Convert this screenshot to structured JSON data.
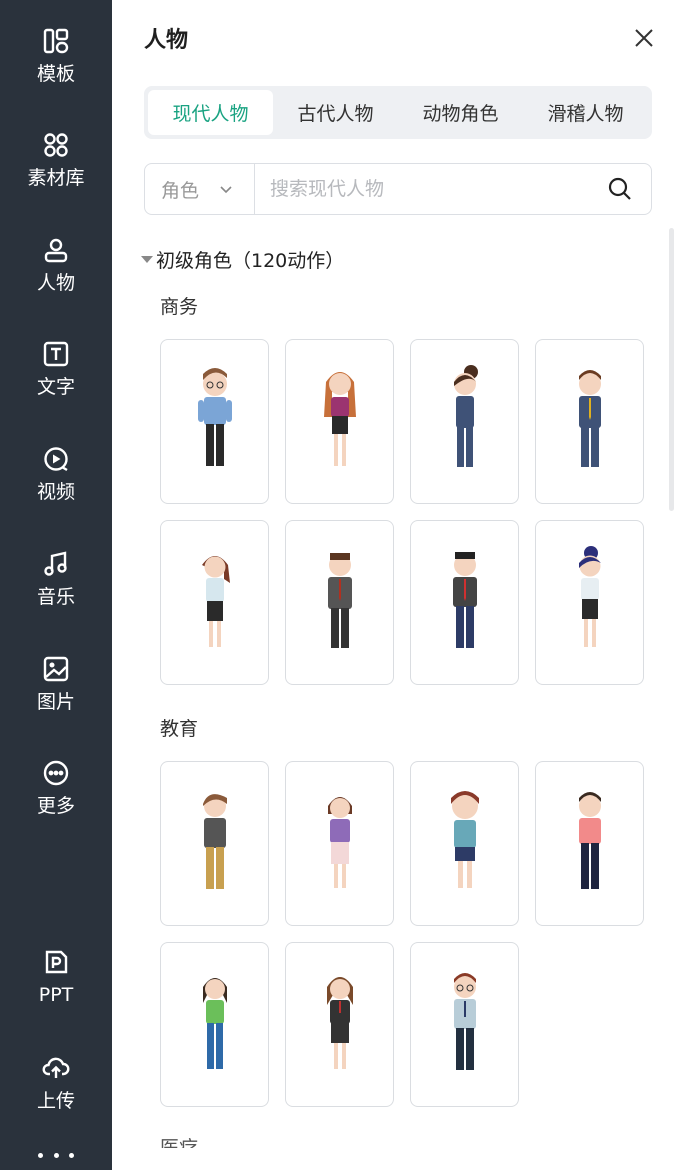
{
  "sidebar": {
    "items": [
      {
        "label": "模板",
        "icon": "template-icon"
      },
      {
        "label": "素材库",
        "icon": "asset-library-icon"
      },
      {
        "label": "人物",
        "icon": "person-icon"
      },
      {
        "label": "文字",
        "icon": "text-icon"
      },
      {
        "label": "视频",
        "icon": "video-icon"
      },
      {
        "label": "音乐",
        "icon": "music-icon"
      },
      {
        "label": "图片",
        "icon": "image-icon"
      },
      {
        "label": "更多",
        "icon": "more-icon"
      },
      {
        "label": "PPT",
        "icon": "ppt-icon"
      },
      {
        "label": "上传",
        "icon": "upload-icon"
      }
    ]
  },
  "panel": {
    "title": "人物",
    "tabs": [
      {
        "label": "现代人物",
        "active": true
      },
      {
        "label": "古代人物",
        "active": false
      },
      {
        "label": "动物角色",
        "active": false
      },
      {
        "label": "滑稽人物",
        "active": false
      }
    ],
    "search": {
      "filter_value": "角色",
      "placeholder": "搜索现代人物"
    },
    "group": {
      "title": "初级角色（120动作）"
    },
    "sections": [
      {
        "label": "商务",
        "count": 8
      },
      {
        "label": "教育",
        "count": 7
      },
      {
        "label": "医疗"
      }
    ]
  },
  "colors": {
    "sidebar_bg": "#2a323c",
    "accent": "#1aa382",
    "tab_bg": "#eef0f3"
  }
}
